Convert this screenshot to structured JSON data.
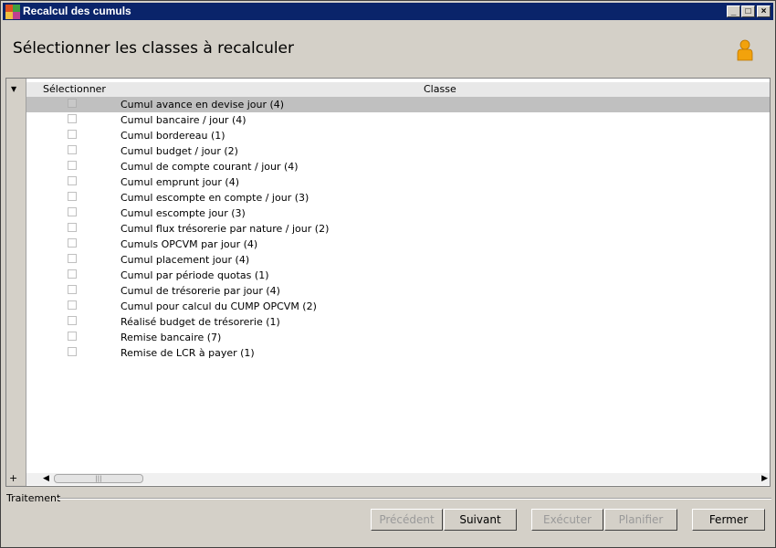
{
  "window": {
    "title": "Recalcul des cumuls",
    "controls": {
      "minimize": "_",
      "maximize": "□",
      "close": "×"
    }
  },
  "header": {
    "title": "Sélectionner les classes à recalculer",
    "icon": "user-icon"
  },
  "grid": {
    "columns": {
      "select": "Sélectionner",
      "class": "Classe"
    },
    "rows": [
      {
        "label": "Cumul avance en devise jour (4)",
        "checked": false,
        "selected": true
      },
      {
        "label": "Cumul bancaire / jour (4)",
        "checked": false
      },
      {
        "label": "Cumul bordereau (1)",
        "checked": false
      },
      {
        "label": "Cumul budget / jour (2)",
        "checked": false
      },
      {
        "label": "Cumul de compte courant / jour (4)",
        "checked": false
      },
      {
        "label": "Cumul emprunt jour (4)",
        "checked": false
      },
      {
        "label": "Cumul escompte en compte / jour (3)",
        "checked": false
      },
      {
        "label": "Cumul escompte jour (3)",
        "checked": false
      },
      {
        "label": "Cumul flux trésorerie par nature / jour (2)",
        "checked": false
      },
      {
        "label": "Cumuls OPCVM par jour (4)",
        "checked": false
      },
      {
        "label": "Cumul placement jour (4)",
        "checked": false
      },
      {
        "label": "Cumul par période quotas (1)",
        "checked": false
      },
      {
        "label": "Cumul de trésorerie par jour (4)",
        "checked": false
      },
      {
        "label": "Cumul pour calcul du CUMP OPCVM (2)",
        "checked": false
      },
      {
        "label": "Réalisé budget de trésorerie (1)",
        "checked": false
      },
      {
        "label": "Remise bancaire (7)",
        "checked": false
      },
      {
        "label": "Remise de LCR à payer (1)",
        "checked": false
      }
    ],
    "plus": "+",
    "scroll_thumb": "|||"
  },
  "footer": {
    "group_label": "Traitement",
    "buttons": {
      "previous": "Précédent",
      "next": "Suivant",
      "execute": "Exécuter",
      "schedule": "Planifier",
      "close": "Fermer"
    }
  }
}
